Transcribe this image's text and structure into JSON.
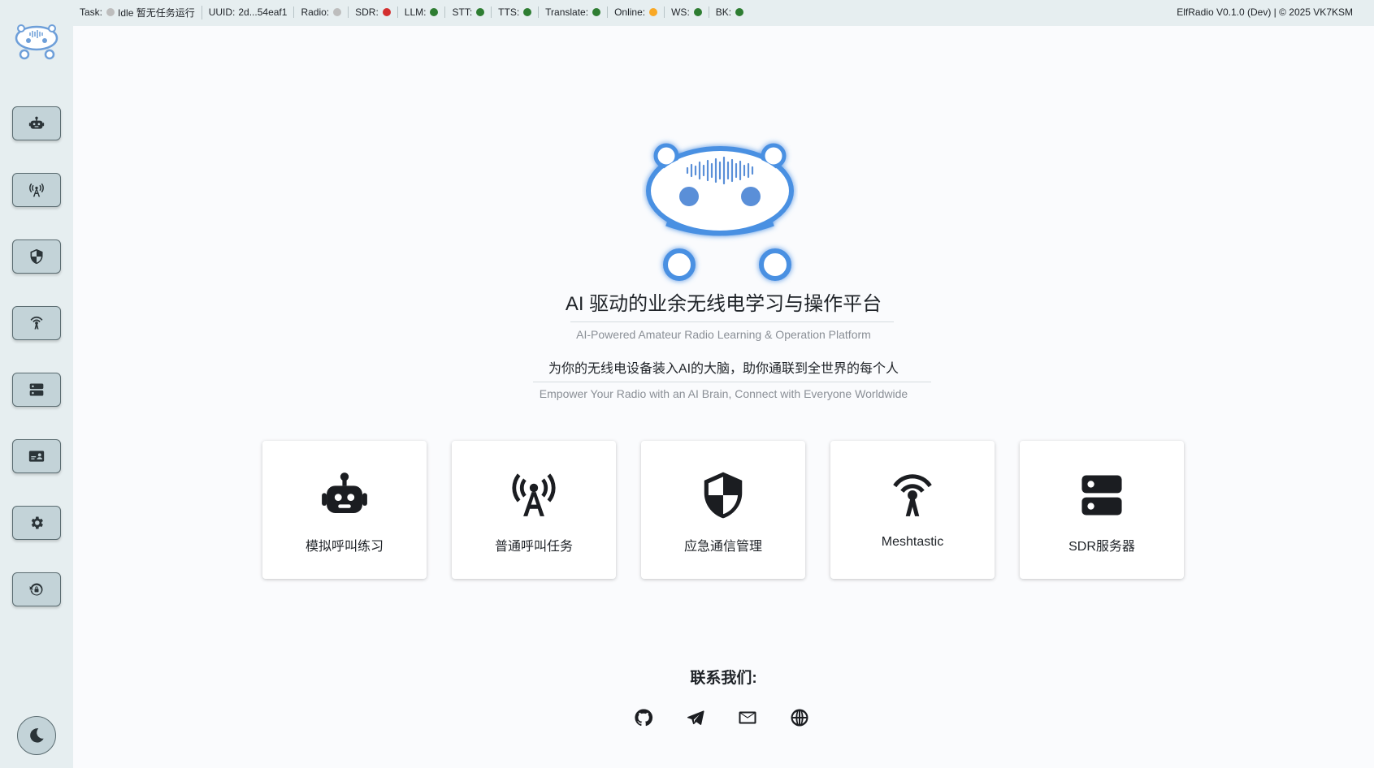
{
  "status": {
    "task_label": "Task:",
    "task_value": "Idle 暂无任务运行",
    "uuid_label": "UUID:",
    "uuid_value": "2d...54eaf1",
    "indicators": [
      {
        "label": "Radio:",
        "color": "#bdbdbd"
      },
      {
        "label": "SDR:",
        "color": "#d32f2f"
      },
      {
        "label": "LLM:",
        "color": "#2e7d32"
      },
      {
        "label": "STT:",
        "color": "#2e7d32"
      },
      {
        "label": "TTS:",
        "color": "#2e7d32"
      },
      {
        "label": "Translate:",
        "color": "#2e7d32"
      },
      {
        "label": "Online:",
        "color": "#f9a825"
      },
      {
        "label": "WS:",
        "color": "#2e7d32"
      },
      {
        "label": "BK:",
        "color": "#2e7d32"
      }
    ],
    "task_dot_color": "#bdbdbd",
    "version": "ElfRadio V0.1.0 (Dev) | © 2025 VK7KSM"
  },
  "sidebar": {
    "items": [
      {
        "icon": "robot-icon"
      },
      {
        "icon": "broadcast-tower-icon"
      },
      {
        "icon": "shield-icon"
      },
      {
        "icon": "meshtastic-icon"
      },
      {
        "icon": "server-icon"
      },
      {
        "icon": "id-card-icon"
      },
      {
        "icon": "gear-icon"
      },
      {
        "icon": "restore-icon"
      }
    ],
    "theme_icon": "moon-icon"
  },
  "main": {
    "title": "AI 驱动的业余无线电学习与操作平台",
    "subtitle": "AI-Powered Amateur Radio Learning & Operation Platform",
    "slogan": "为你的无线电设备装入AI的大脑，助你通联到全世界的每个人",
    "slogan_en": "Empower Your Radio with an AI Brain, Connect with Everyone Worldwide",
    "cards": [
      {
        "label": "模拟呼叫练习",
        "icon": "robot-icon"
      },
      {
        "label": "普通呼叫任务",
        "icon": "broadcast-tower-icon"
      },
      {
        "label": "应急通信管理",
        "icon": "shield-icon"
      },
      {
        "label": "Meshtastic",
        "icon": "meshtastic-icon"
      },
      {
        "label": "SDR服务器",
        "icon": "server-icon"
      }
    ],
    "contact_title": "联系我们:",
    "contact_icons": [
      "github-icon",
      "telegram-icon",
      "mail-icon",
      "globe-icon"
    ]
  },
  "colors": {
    "accent": "#4a90e2",
    "sidebar_bg": "#e6eef0",
    "button_bg": "#c3d3d8"
  }
}
